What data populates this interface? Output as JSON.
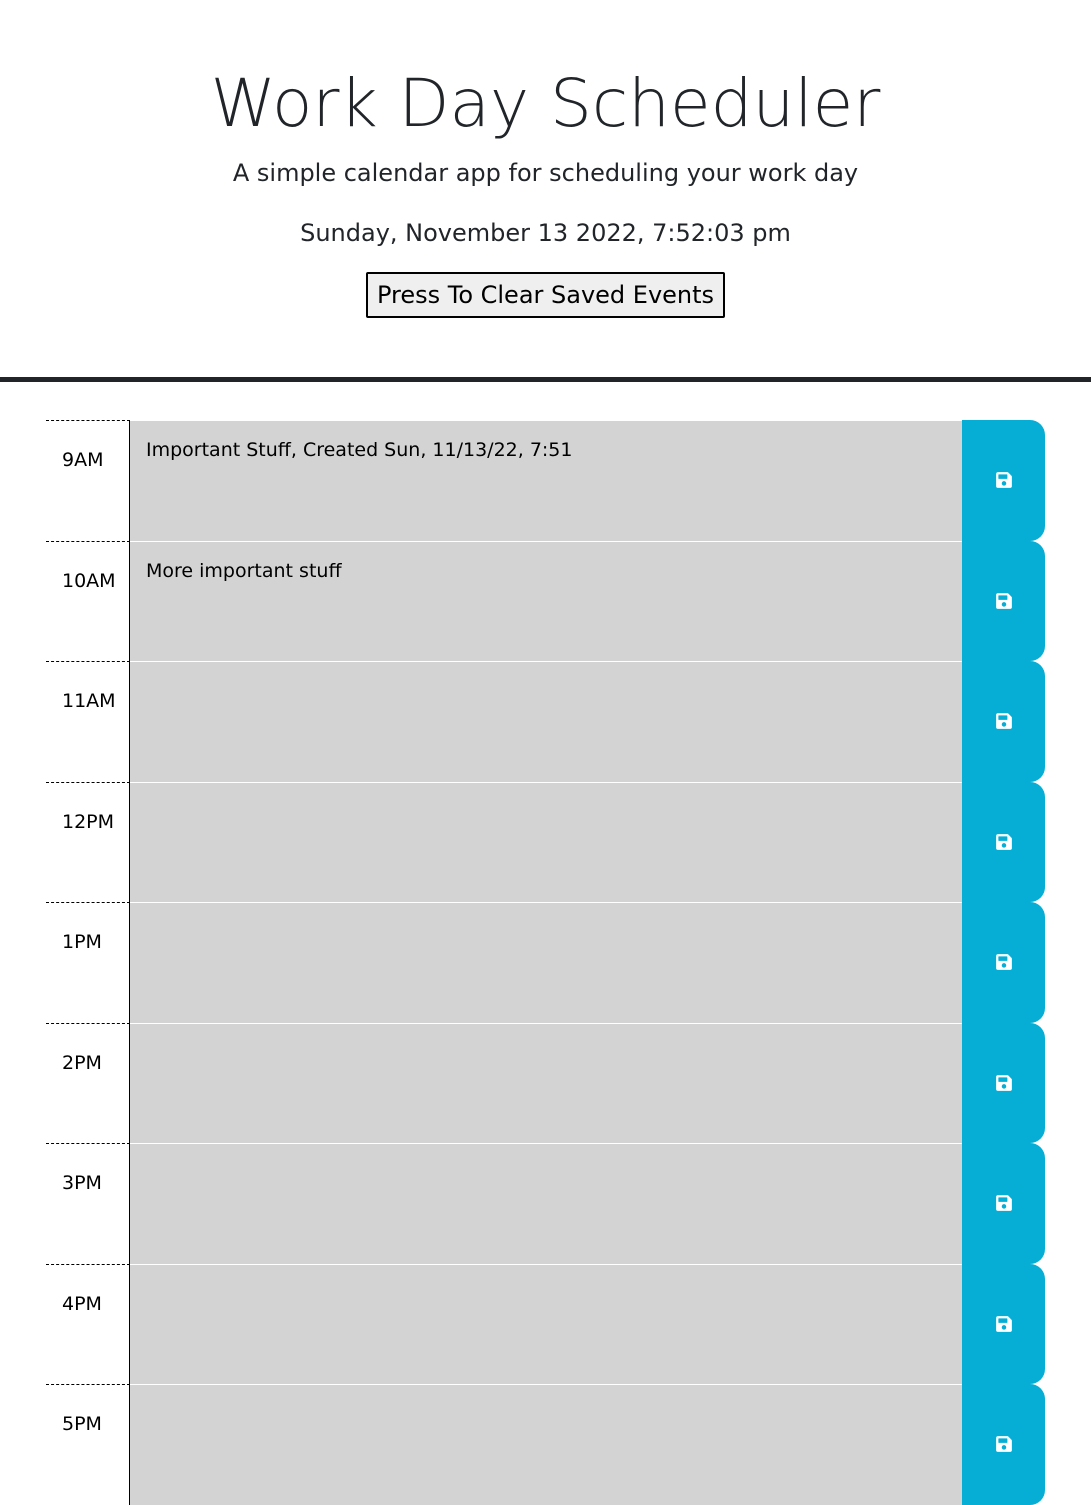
{
  "header": {
    "title": "Work Day Scheduler",
    "lead": "A simple calendar app for scheduling your work day",
    "current_day": "Sunday, November 13 2022, 7:52:03 pm",
    "clear_button_label": "Press To Clear Saved Events"
  },
  "time_blocks": [
    {
      "hour": "9AM",
      "event": "Important Stuff, Created Sun, 11/13/22, 7:51"
    },
    {
      "hour": "10AM",
      "event": "More important stuff"
    },
    {
      "hour": "11AM",
      "event": ""
    },
    {
      "hour": "12PM",
      "event": ""
    },
    {
      "hour": "1PM",
      "event": ""
    },
    {
      "hour": "2PM",
      "event": ""
    },
    {
      "hour": "3PM",
      "event": ""
    },
    {
      "hour": "4PM",
      "event": ""
    },
    {
      "hour": "5PM",
      "event": ""
    }
  ],
  "save_icon": "floppy-disk-icon",
  "colors": {
    "past_block": "#d3d3d3",
    "save_button": "#06aed5",
    "header_rule": "#212529"
  }
}
